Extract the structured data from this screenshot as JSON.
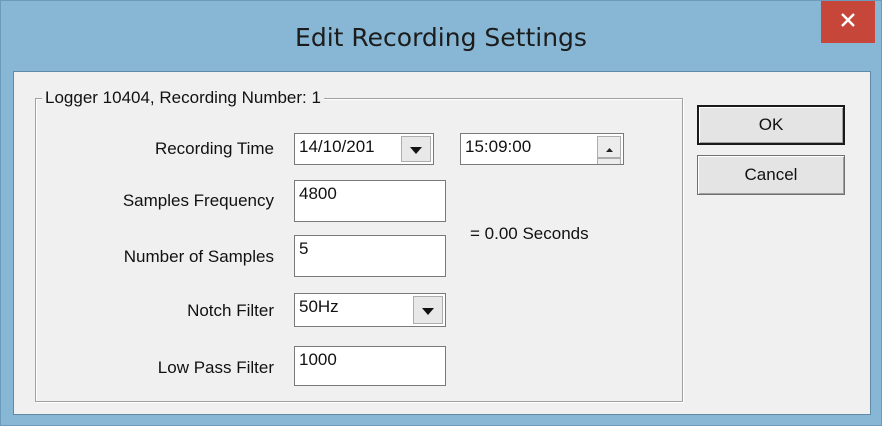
{
  "window": {
    "title": "Edit Recording Settings",
    "close_icon": "close-icon"
  },
  "group": {
    "legend": "Logger 10404, Recording Number: 1"
  },
  "fields": {
    "recording_time_label": "Recording Time",
    "recording_date_value": "14/10/201",
    "recording_time_value": "15:09:00",
    "samples_frequency_label": "Samples Frequency",
    "samples_frequency_value": "4800",
    "number_of_samples_label": "Number of Samples",
    "number_of_samples_value": "5",
    "notch_filter_label": "Notch Filter",
    "notch_filter_value": "50Hz",
    "low_pass_filter_label": "Low Pass Filter",
    "low_pass_filter_value": "1000"
  },
  "duration_text": "= 0.00 Seconds",
  "buttons": {
    "ok_label": "OK",
    "cancel_label": "Cancel"
  },
  "colors": {
    "title_bar": "#87b7d4",
    "close_button": "#c7463a",
    "dialog_face": "#f0f0f0"
  }
}
